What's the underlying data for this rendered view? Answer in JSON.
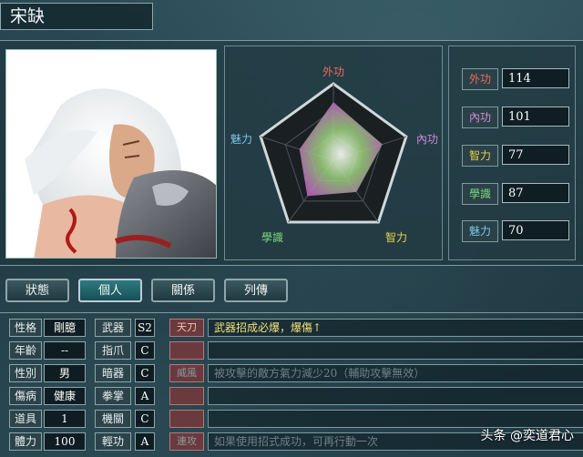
{
  "character": {
    "name": "宋缺"
  },
  "radar": {
    "labels": {
      "top": "外功",
      "right": "內功",
      "bottom_right": "智力",
      "bottom_left": "學識",
      "left": "魅力"
    },
    "values": [
      114,
      101,
      77,
      87,
      70
    ],
    "max": 150
  },
  "stats": [
    {
      "label": "外功",
      "value": "114",
      "color": "#f06a5a"
    },
    {
      "label": "內功",
      "value": "101",
      "color": "#d48ad8"
    },
    {
      "label": "智力",
      "value": "77",
      "color": "#e8d24a"
    },
    {
      "label": "學識",
      "value": "87",
      "color": "#7ad87a"
    },
    {
      "label": "魅力",
      "value": "70",
      "color": "#7fc4e8"
    }
  ],
  "tabs": [
    "狀態",
    "個人",
    "關係",
    "列傳"
  ],
  "active_tab": 1,
  "info": [
    {
      "k": "性格",
      "v": "剛臆"
    },
    {
      "k": "年齡",
      "v": "--"
    },
    {
      "k": "性別",
      "v": "男"
    },
    {
      "k": "傷病",
      "v": "健康"
    },
    {
      "k": "道具",
      "v": "1"
    },
    {
      "k": "體力",
      "v": "100"
    }
  ],
  "arts": [
    {
      "k": "武器",
      "v": "S2"
    },
    {
      "k": "指爪",
      "v": "C"
    },
    {
      "k": "暗器",
      "v": "C"
    },
    {
      "k": "拳掌",
      "v": "A"
    },
    {
      "k": "機關",
      "v": "C"
    },
    {
      "k": "輕功",
      "v": "A"
    }
  ],
  "skills": [
    {
      "name": "天刀",
      "desc": "武器招成必爆，爆傷↑",
      "color": "#f2e07a"
    },
    {
      "name": "",
      "desc": "",
      "color": "#ddd"
    },
    {
      "name": "威風",
      "desc": "被攻擊的敵方氣力減少20（輔助攻擊無效）",
      "color": "#6f8088"
    },
    {
      "name": "",
      "desc": "",
      "color": "#ddd"
    },
    {
      "name": "",
      "desc": "",
      "color": "#ddd"
    },
    {
      "name": "連攻",
      "desc": "如果使用招式成功，可再行動一次",
      "color": "#6f8088"
    }
  ],
  "watermark": "头条 @奕道君心"
}
